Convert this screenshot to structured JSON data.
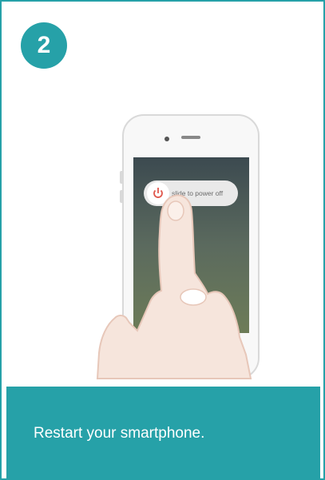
{
  "step": {
    "number": "2"
  },
  "phone": {
    "slider_text": "slide to power off"
  },
  "caption": {
    "text": "Restart your smartphone."
  },
  "colors": {
    "accent": "#26a1a8",
    "power_icon": "#e0584d"
  },
  "icons": [
    "power-icon"
  ]
}
